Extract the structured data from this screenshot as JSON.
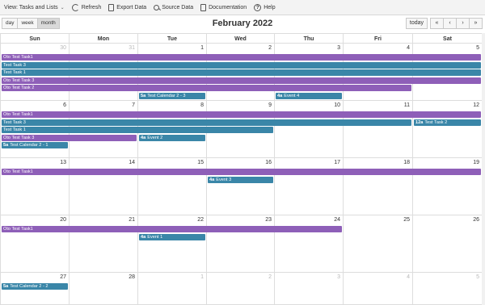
{
  "toolbar": {
    "view_label": "View: Tasks and Lists",
    "refresh": "Refresh",
    "export": "Export Data",
    "source": "Source Data",
    "documentation": "Documentation",
    "help": "Help"
  },
  "view_buttons": [
    "day",
    "week",
    "month"
  ],
  "title": "February 2022",
  "nav": {
    "today": "today",
    "prev_year": "«",
    "prev": "‹",
    "next": "›",
    "next_year": "»"
  },
  "weekdays": [
    "Sun",
    "Mon",
    "Tue",
    "Wed",
    "Thu",
    "Fri",
    "Sat"
  ],
  "weeks": [
    {
      "days": [
        {
          "n": "30",
          "other": true
        },
        {
          "n": "31",
          "other": true
        },
        {
          "n": "1"
        },
        {
          "n": "2"
        },
        {
          "n": "3"
        },
        {
          "n": "4"
        },
        {
          "n": "5"
        }
      ],
      "events": [
        {
          "start": 0,
          "span": 7,
          "lane": 0,
          "color": "purple",
          "time": "",
          "label": "Oto Test Task1"
        },
        {
          "start": 0,
          "span": 7,
          "lane": 1,
          "color": "teal",
          "time": "",
          "label": "Test Task 3"
        },
        {
          "start": 0,
          "span": 7,
          "lane": 2,
          "color": "teal",
          "time": "",
          "label": "Test Task 1"
        },
        {
          "start": 0,
          "span": 7,
          "lane": 3,
          "color": "purple",
          "time": "",
          "label": "Oto Test Task 3"
        },
        {
          "start": 0,
          "span": 6,
          "lane": 4,
          "color": "purple",
          "time": "",
          "label": "Oto Test Task 2"
        },
        {
          "start": 2,
          "span": 1,
          "lane": 5,
          "color": "teal",
          "time": "5a",
          "label": "Test Calendar 2 - 3"
        },
        {
          "start": 4,
          "span": 1,
          "lane": 5,
          "color": "teal",
          "time": "4a",
          "label": "Event 4"
        }
      ]
    },
    {
      "days": [
        {
          "n": "6"
        },
        {
          "n": "7"
        },
        {
          "n": "8"
        },
        {
          "n": "9"
        },
        {
          "n": "10"
        },
        {
          "n": "11"
        },
        {
          "n": "12"
        }
      ],
      "events": [
        {
          "start": 0,
          "span": 7,
          "lane": 0,
          "color": "purple",
          "time": "",
          "label": "Oto Test Task1"
        },
        {
          "start": 0,
          "span": 6,
          "lane": 1,
          "color": "teal",
          "time": "",
          "label": "Test Task 3"
        },
        {
          "start": 6,
          "span": 1,
          "lane": 1,
          "color": "teal",
          "time": "12a",
          "label": "Test Task 2"
        },
        {
          "start": 0,
          "span": 4,
          "lane": 2,
          "color": "teal",
          "time": "",
          "label": "Test Task 1"
        },
        {
          "start": 0,
          "span": 2,
          "lane": 3,
          "color": "purple",
          "time": "",
          "label": "Oto Test Task 3"
        },
        {
          "start": 2,
          "span": 1,
          "lane": 3,
          "color": "teal",
          "time": "4a",
          "label": "Event 2"
        },
        {
          "start": 0,
          "span": 1,
          "lane": 4,
          "color": "teal",
          "time": "5a",
          "label": "Test Calendar 2 - 1"
        }
      ]
    },
    {
      "days": [
        {
          "n": "13"
        },
        {
          "n": "14"
        },
        {
          "n": "15"
        },
        {
          "n": "16"
        },
        {
          "n": "17"
        },
        {
          "n": "18"
        },
        {
          "n": "19"
        }
      ],
      "events": [
        {
          "start": 0,
          "span": 7,
          "lane": 0,
          "color": "purple",
          "time": "",
          "label": "Oto Test Task1"
        },
        {
          "start": 3,
          "span": 1,
          "lane": 1,
          "color": "teal",
          "time": "4a",
          "label": "Event 3"
        }
      ]
    },
    {
      "days": [
        {
          "n": "20"
        },
        {
          "n": "21"
        },
        {
          "n": "22"
        },
        {
          "n": "23"
        },
        {
          "n": "24"
        },
        {
          "n": "25"
        },
        {
          "n": "26"
        }
      ],
      "events": [
        {
          "start": 0,
          "span": 5,
          "lane": 0,
          "color": "purple",
          "time": "",
          "label": "Oto Test Task1"
        },
        {
          "start": 2,
          "span": 1,
          "lane": 1,
          "color": "teal",
          "time": "4a",
          "label": "Event 1"
        }
      ]
    },
    {
      "days": [
        {
          "n": "27"
        },
        {
          "n": "28"
        },
        {
          "n": "1",
          "other": true
        },
        {
          "n": "2",
          "other": true
        },
        {
          "n": "3",
          "other": true
        },
        {
          "n": "4",
          "other": true
        },
        {
          "n": "5",
          "other": true
        }
      ],
      "events": [
        {
          "start": 0,
          "span": 1,
          "lane": 0,
          "color": "teal",
          "time": "5a",
          "label": "Test Calendar 2 - 2"
        }
      ]
    }
  ]
}
